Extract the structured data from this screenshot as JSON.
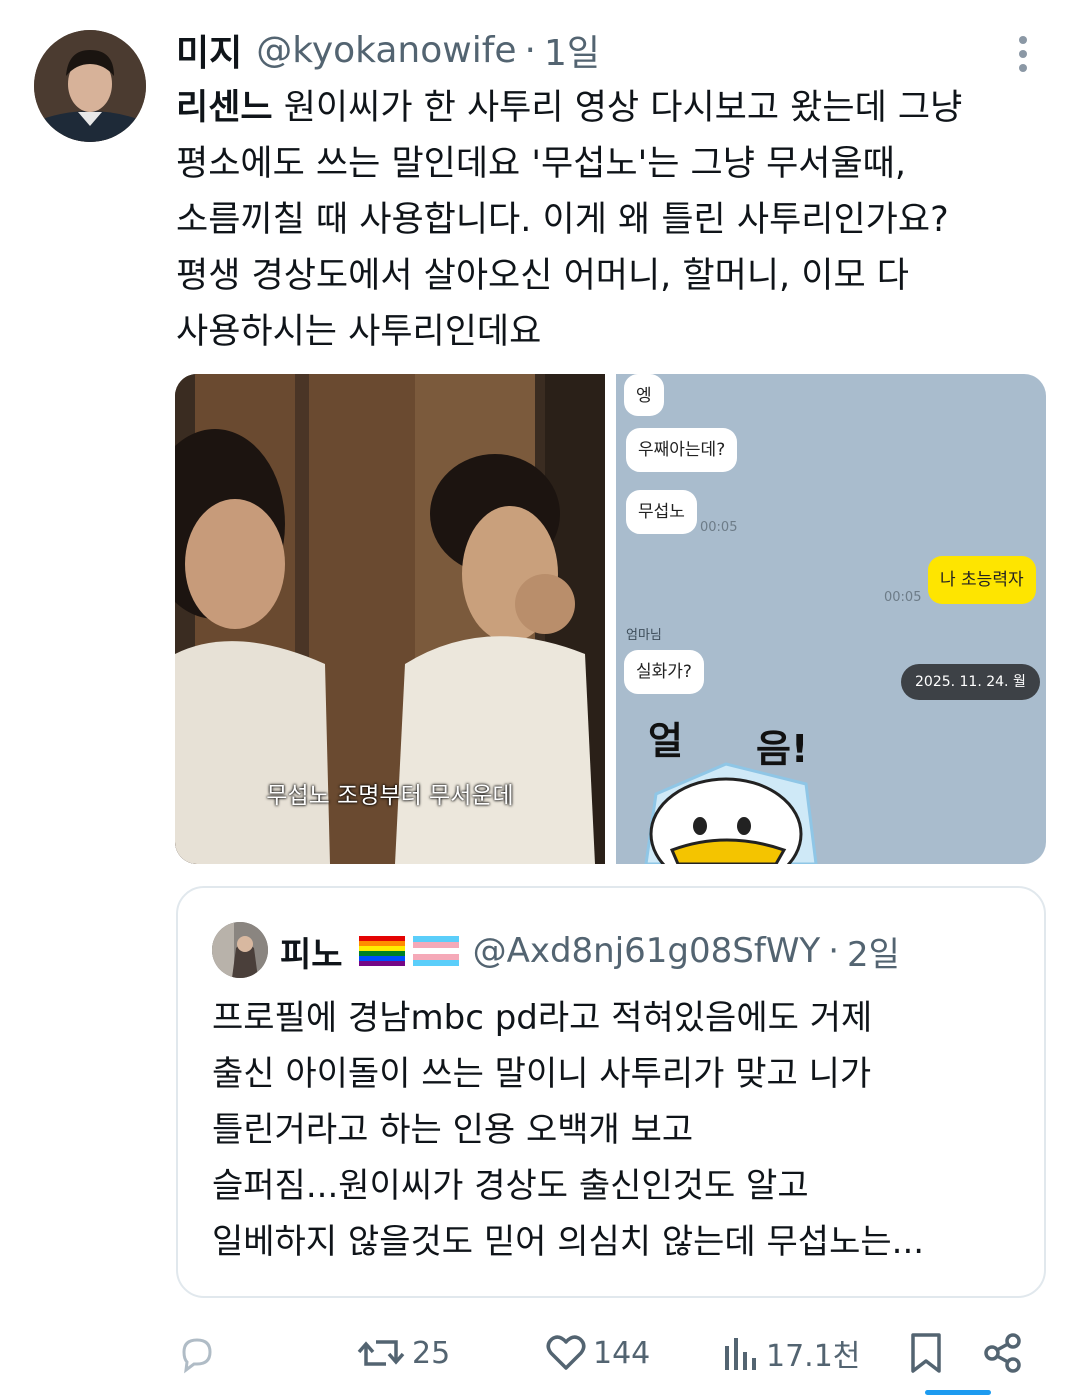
{
  "author": {
    "display_name": "미지",
    "handle": "@kyokanowife",
    "separator": "·",
    "time": "1일"
  },
  "tweet": {
    "mention": "리센느",
    "lines": [
      " 원이씨가 한 사투리 영상 다시보고 왔는데 그냥",
      "평소에도 쓰는 말인데요 '무섭노'는 그냥 무서울때,",
      "소름끼칠 때 사용합니다. 이게 왜 틀린 사투리인가요?",
      "평생 경상도에서 살아오신 어머니, 할머니, 이모 다",
      "사용하시는 사투리인데요"
    ]
  },
  "media": {
    "left": {
      "subtitle": "무섭노 조명부터 무서운데"
    },
    "right": {
      "bubbles": [
        "엥",
        "우째아는데?",
        "무섭노",
        "나 초능력자",
        "실화가?"
      ],
      "times": [
        "00:05",
        "00:05"
      ],
      "sender": "엄마님",
      "date": "2025. 11. 24. 월",
      "sticker": [
        "얼",
        "음!"
      ]
    }
  },
  "quote": {
    "display_name": "피노",
    "handle": "@Axd8nj61g08SfWY",
    "separator": "·",
    "time": "2일",
    "lines": [
      "프로필에 경남mbc pd라고 적혀있음에도 거제",
      "출신 아이돌이 쓰는 말이니 사투리가 맞고 니가",
      "틀린거라고 하는 인용 오백개 보고",
      "슬퍼짐...원이씨가 경상도 출신인것도 알고",
      "일베하지 않을것도 믿어 의심치 않는데 무섭노는..."
    ]
  },
  "actions": {
    "reply_icon": "reply-icon",
    "retweets": "25",
    "likes": "144",
    "views": "17.1천"
  },
  "colors": {
    "secondary_text": "#536471",
    "border": "#e1e8ed",
    "chat_bg": "#a9bccd",
    "chat_yellow": "#fee500",
    "accent": "#1d9bf0"
  }
}
